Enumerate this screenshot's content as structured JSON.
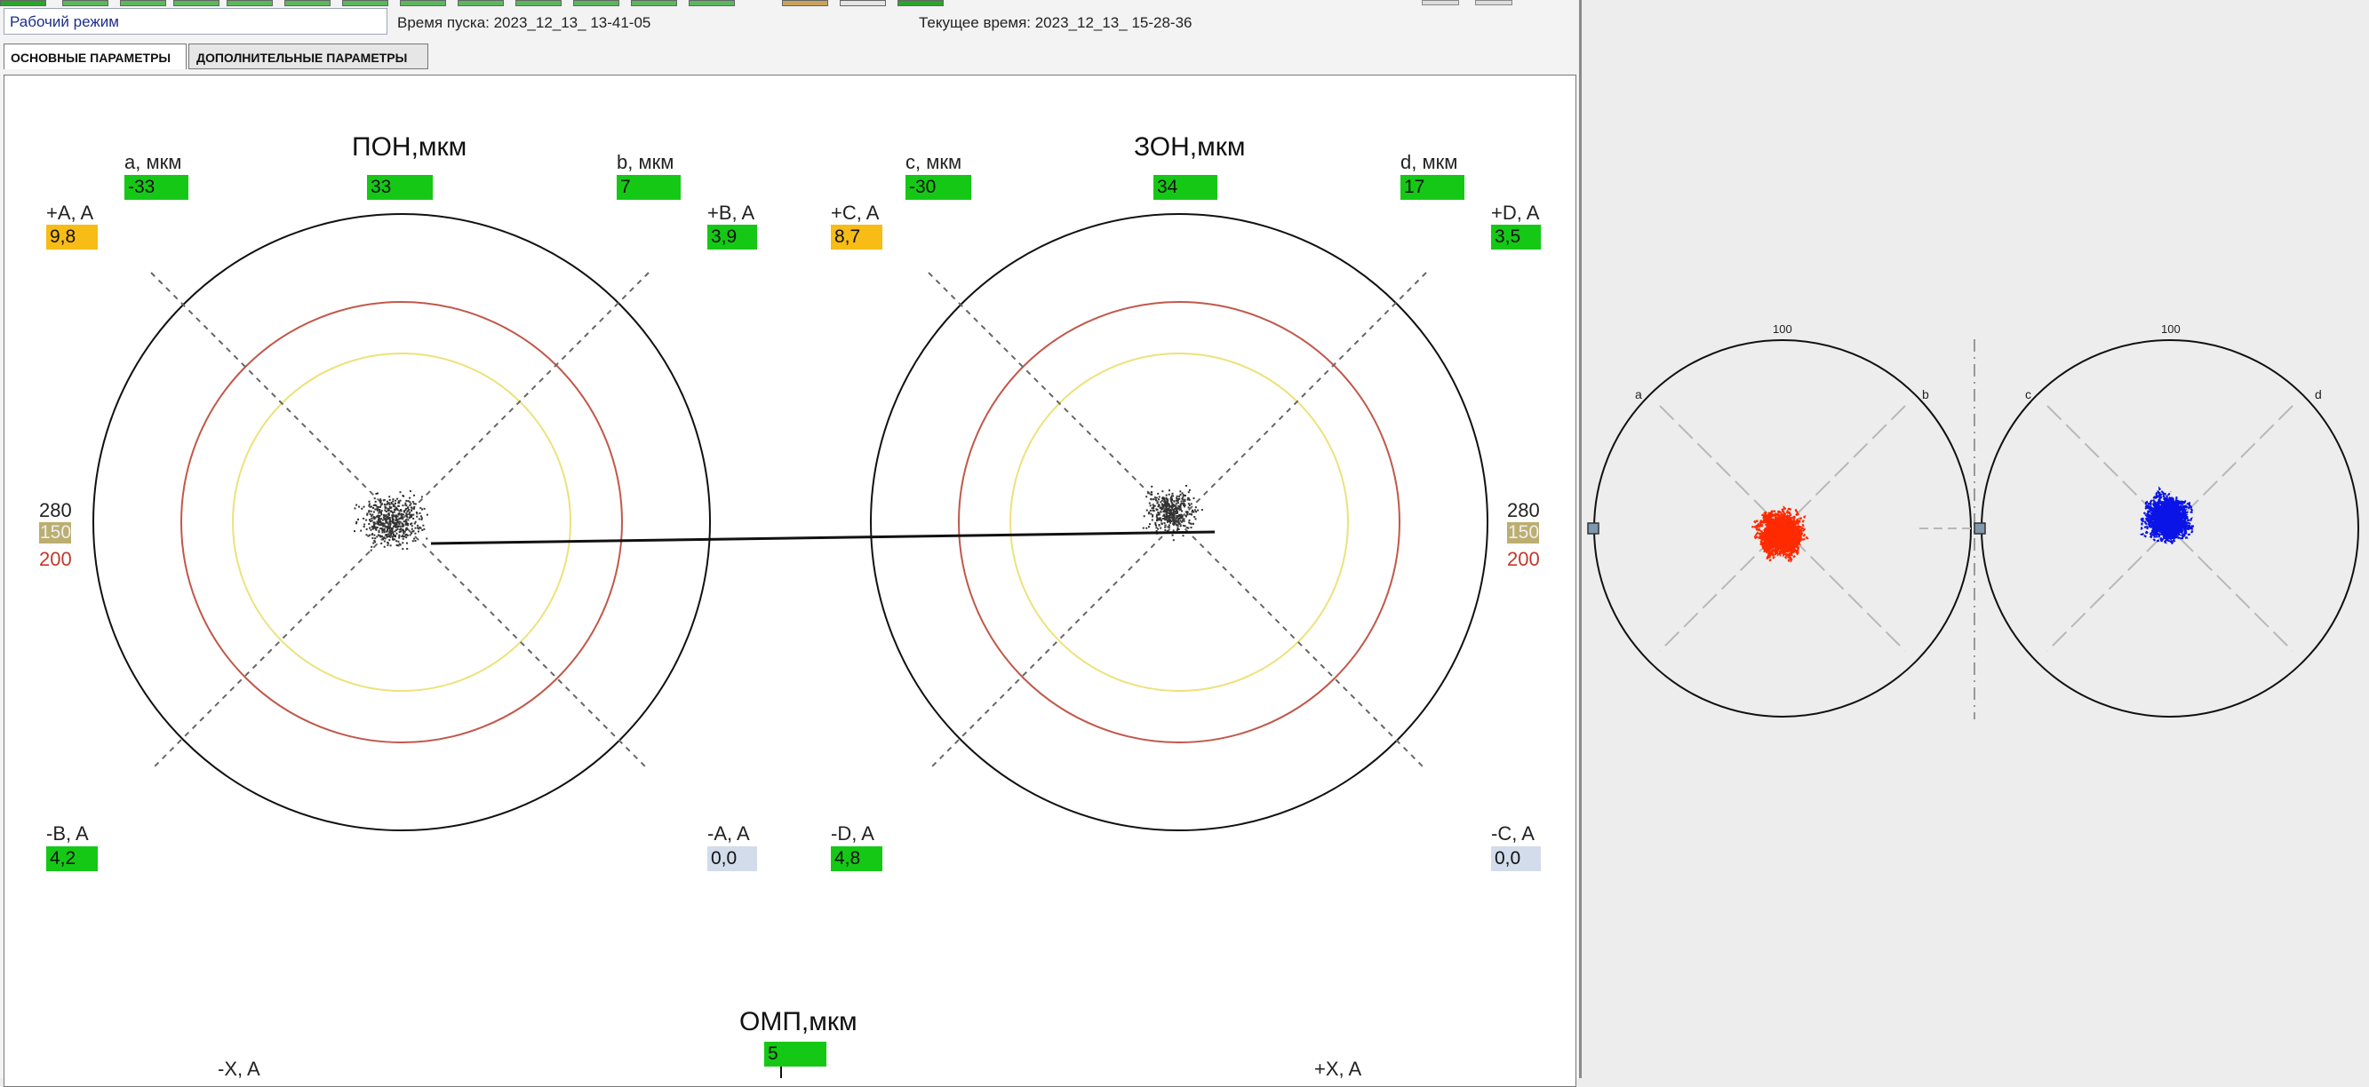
{
  "colors": {
    "window_bg": "#ffffff",
    "panel_bg": "#ededed",
    "green": "#16c816",
    "orange": "#f7bc16",
    "light_blue": "#d2dceb",
    "red_ring": "#c0584a",
    "yellow_ring": "#ece27a",
    "red_trace": "#ff2a00",
    "blue_trace": "#0a14e6"
  },
  "header": {
    "mode_value": "Рабочий режим",
    "start_time": "Время пуска: 2023_12_13_ 13-41-05",
    "current_time": "Текущее время: 2023_12_13_ 15-28-36"
  },
  "tabs": [
    "ОСНОВНЫЕ ПАРАМЕТРЫ",
    "ДОПОЛНИТЕЛЬНЫЕ ПАРАМЕТРЫ"
  ],
  "pon": {
    "title": "ПОН,мкм",
    "value": "33",
    "a_label": "a, мкм",
    "a_value": "-33",
    "b_label": "b, мкм",
    "b_value": "7",
    "plusA_label": "+A, A",
    "plusA_value": "9,8",
    "plusB_label": "+B, A",
    "plusB_value": "3,9",
    "minusB_label": "-B, A",
    "minusB_value": "4,2",
    "minusA_label": "-A, A",
    "minusA_value": "0,0",
    "scale_280": "280",
    "scale_150": "150",
    "scale_200": "200"
  },
  "zon": {
    "title": "ЗОН,мкм",
    "value": "34",
    "c_label": "c, мкм",
    "c_value": "-30",
    "d_label": "d, мкм",
    "d_value": "17",
    "plusC_label": "+C, A",
    "plusC_value": "8,7",
    "plusD_label": "+D, A",
    "plusD_value": "3,5",
    "minusD_label": "-D, A",
    "minusD_value": "4,8",
    "minusC_label": "-C, A",
    "minusC_value": "0,0",
    "scale_280": "280",
    "scale_150": "150",
    "scale_200": "200"
  },
  "omp": {
    "title": "ОМП,мкм",
    "value": "5",
    "minusX_label": "-X, A",
    "plusX_label": "+X, A"
  },
  "mini_plots": {
    "left": {
      "top_label": "100",
      "a_label": "a",
      "b_label": "b"
    },
    "right": {
      "top_label": "100",
      "c_label": "c",
      "d_label": "d"
    }
  }
}
